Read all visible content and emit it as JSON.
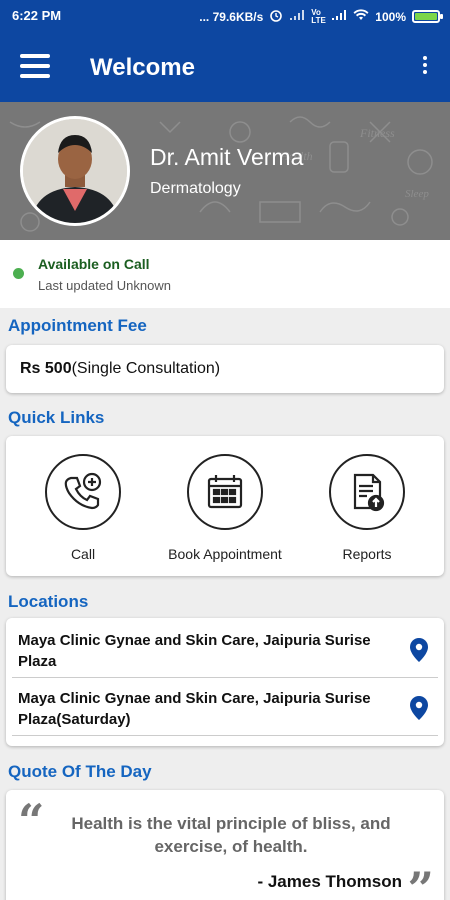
{
  "status_bar": {
    "time": "6:22 PM",
    "network_speed": "... 79.6KB/s",
    "network_type": "Vo LTE",
    "battery": "100%"
  },
  "app_bar": {
    "title": "Welcome"
  },
  "profile": {
    "name": "Dr. Amit Verma",
    "specialty": "Dermatology"
  },
  "availability": {
    "status": "Available on Call",
    "updated": "Last updated Unknown",
    "color": "#4caf50"
  },
  "appointment_fee": {
    "title": "Appointment Fee",
    "amount": "Rs 500",
    "description": "(Single Consultation)"
  },
  "quick_links": {
    "title": "Quick Links",
    "items": [
      {
        "label": "Call",
        "icon": "phone-plus-icon"
      },
      {
        "label": "Book Appointment",
        "icon": "calendar-icon"
      },
      {
        "label": "Reports",
        "icon": "report-upload-icon"
      }
    ]
  },
  "locations": {
    "title": "Locations",
    "items": [
      {
        "name": "Maya Clinic Gynae and Skin Care,  Jaipuria Surise Plaza",
        "icon": "map-pin-icon"
      },
      {
        "name": "Maya Clinic Gynae and Skin Care, Jaipuria Surise Plaza(Saturday)",
        "icon": "map-pin-icon"
      }
    ]
  },
  "quote": {
    "title": "Quote Of The Day",
    "text": "Health is the vital principle of bliss, and exercise, of health.",
    "author": "- James Thomson"
  },
  "colors": {
    "primary": "#0d47a1",
    "section_title": "#1565c0",
    "pin": "#0d47a1"
  }
}
